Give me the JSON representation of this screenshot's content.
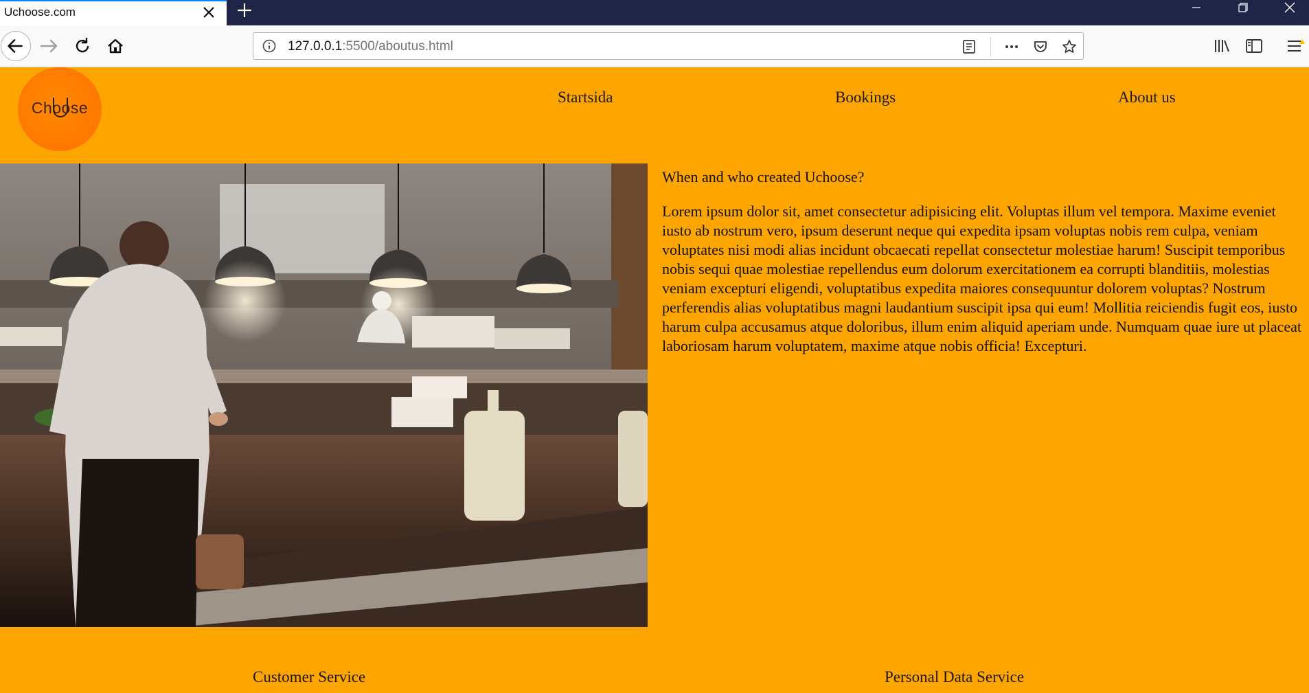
{
  "browser": {
    "tab_title": "Uchoose.com",
    "url_host": "127.0.0.1",
    "url_rest": ":5500/aboutus.html"
  },
  "site": {
    "logo_text": "Choose",
    "nav": [
      "Startsida",
      "Bookings",
      "About us"
    ]
  },
  "article": {
    "heading": "When and who created Uchoose?",
    "body": "Lorem ipsum dolor sit, amet consectetur adipisicing elit. Voluptas illum vel tempora. Maxime eveniet iusto ab nostrum vero, ipsum deserunt neque qui expedita ipsam voluptas nobis rem culpa, veniam voluptates nisi modi alias incidunt obcaecati repellat consectetur molestiae harum! Suscipit temporibus nobis sequi quae molestiae repellendus eum dolorum exercitationem ea corrupti blanditiis, molestias veniam excepturi eligendi, voluptatibus expedita maiores consequuntur dolorem voluptas? Nostrum perferendis alias voluptatibus magni laudantium suscipit ipsa qui eum! Mollitia reiciendis fugit eos, iusto harum culpa accusamus atque doloribus, illum enim aliquid aperiam unde. Numquam quae iure ut placeat laboriosam harum voluptatem, maxime atque nobis officia! Excepturi."
  },
  "footer": {
    "links": [
      "Customer Service",
      "Personal Data Service"
    ]
  },
  "colors": {
    "page_background": "#ffa500",
    "logo_orange": "#ff7a00",
    "tabbar": "#1f2547"
  },
  "icons": [
    "close-icon",
    "plus-icon",
    "back-arrow-icon",
    "forward-arrow-icon",
    "reload-icon",
    "home-icon",
    "info-icon",
    "reader-view-icon",
    "more-icon",
    "pocket-icon",
    "star-icon",
    "library-icon",
    "sidebar-icon",
    "hamburger-menu-icon"
  ]
}
